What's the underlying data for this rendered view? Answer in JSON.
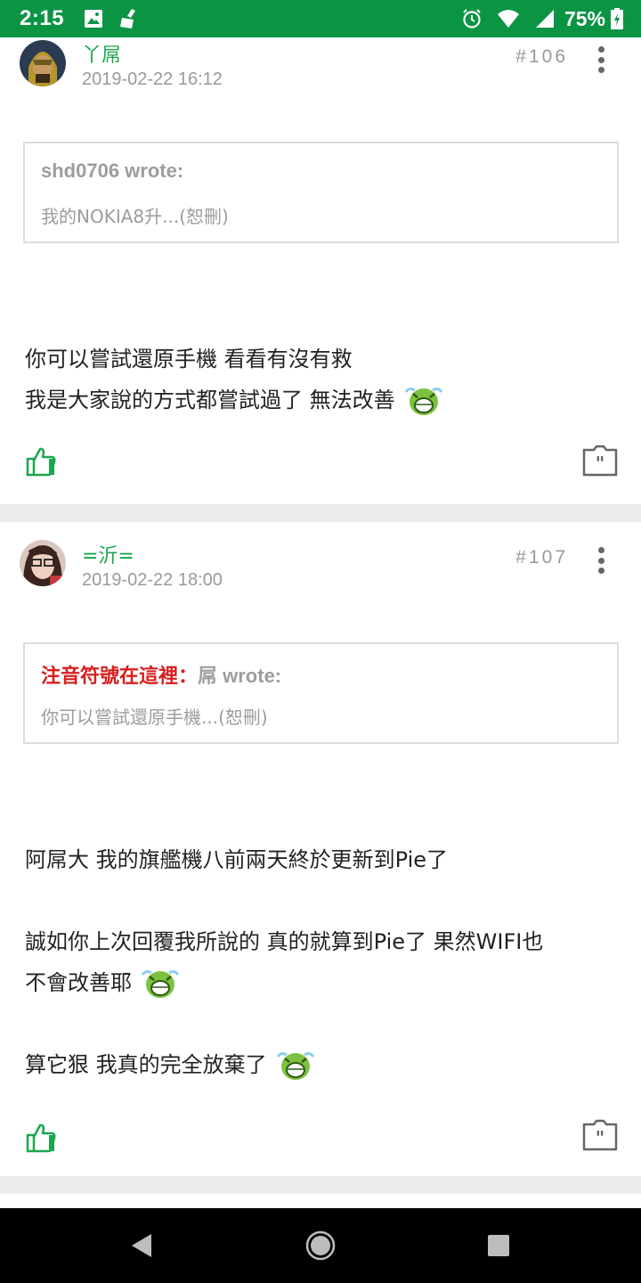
{
  "status_bar": {
    "time": "2:15",
    "battery_percent": "75%",
    "left_icons": [
      "image-icon",
      "broom-icon"
    ],
    "right_icons": [
      "alarm-icon",
      "wifi-icon",
      "signal-icon",
      "battery-charging-icon"
    ]
  },
  "posts": [
    {
      "username": "丫屌",
      "timestamp": "2019-02-22 16:12",
      "floor": "#106",
      "quote": {
        "author_highlight": "",
        "author": "shd0706 wrote:",
        "body": "我的NOKIA8升...(恕刪)"
      },
      "lines": [
        "你可以嘗試還原手機 看看有沒有救",
        "我是大家說的方式都嘗試過了 無法改善"
      ]
    },
    {
      "username": "=沂=",
      "timestamp": "2019-02-22 18:00",
      "floor": "#107",
      "quote": {
        "author_highlight": "注音符號在這裡：",
        "author": "屌 wrote:",
        "body": "你可以嘗試還原手機...(恕刪)"
      },
      "lines": [
        "阿屌大 我的旗艦機八前兩天終於更新到Pie了",
        "誠如你上次回覆我所說的 真的就算到Pie了 果然WIFI也",
        "不會改善耶",
        "算它狠 我真的完全放棄了"
      ]
    }
  ],
  "colors": {
    "status_bar": "#0b9444",
    "username": "#1aa64e",
    "quote_highlight": "#d81e1e",
    "like_icon": "#1aa64e"
  },
  "nav_bar": {
    "icons": [
      "back-icon",
      "home-icon",
      "recents-icon"
    ]
  }
}
